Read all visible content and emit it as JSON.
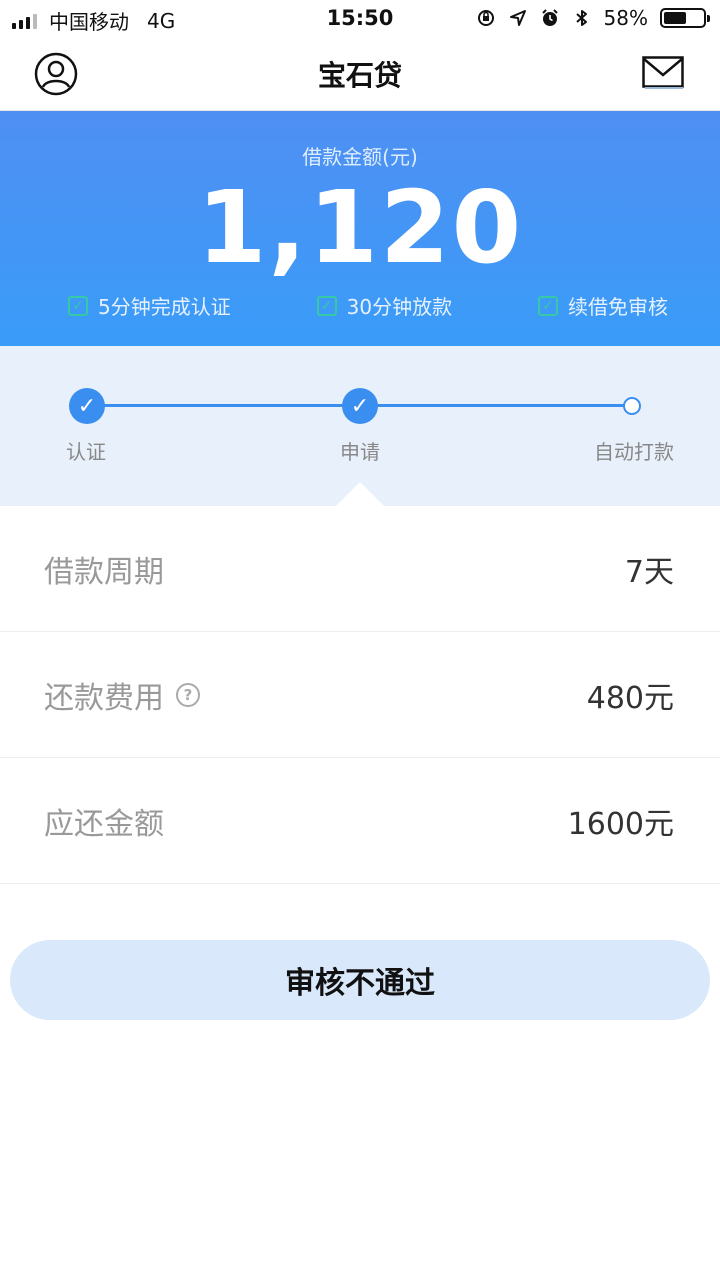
{
  "status_bar": {
    "carrier": "中国移动",
    "network": "4G",
    "time": "15:50",
    "battery": "58%",
    "battery_level": 0.58,
    "icons": [
      "orientation-lock-icon",
      "location-icon",
      "alarm-icon",
      "bluetooth-icon",
      "battery-icon"
    ]
  },
  "nav": {
    "title": "宝石贷",
    "left_icon": "user-avatar-icon",
    "right_icon": "mail-icon"
  },
  "hero": {
    "label": "借款金额(元)",
    "amount": "1,120",
    "features": [
      "5分钟完成认证",
      "30分钟放款",
      "续借免审核"
    ]
  },
  "steps": [
    {
      "label": "认证",
      "state": "done"
    },
    {
      "label": "申请",
      "state": "done"
    },
    {
      "label": "自动打款",
      "state": "pending"
    }
  ],
  "rows": [
    {
      "label": "借款周期",
      "value": "7天"
    },
    {
      "label": "还款费用",
      "value": "480元",
      "help": "?"
    },
    {
      "label": "应还金额",
      "value": "1600元"
    }
  ],
  "action": {
    "label": "审核不通过"
  },
  "colors": {
    "primary": "#3a8ef0",
    "hero_top": "#4f8ff3",
    "hero_bottom": "#3a9cf8",
    "steps_bg": "#e8f1fb",
    "check": "#35c9a6",
    "button_bg": "#d9e8fa"
  }
}
